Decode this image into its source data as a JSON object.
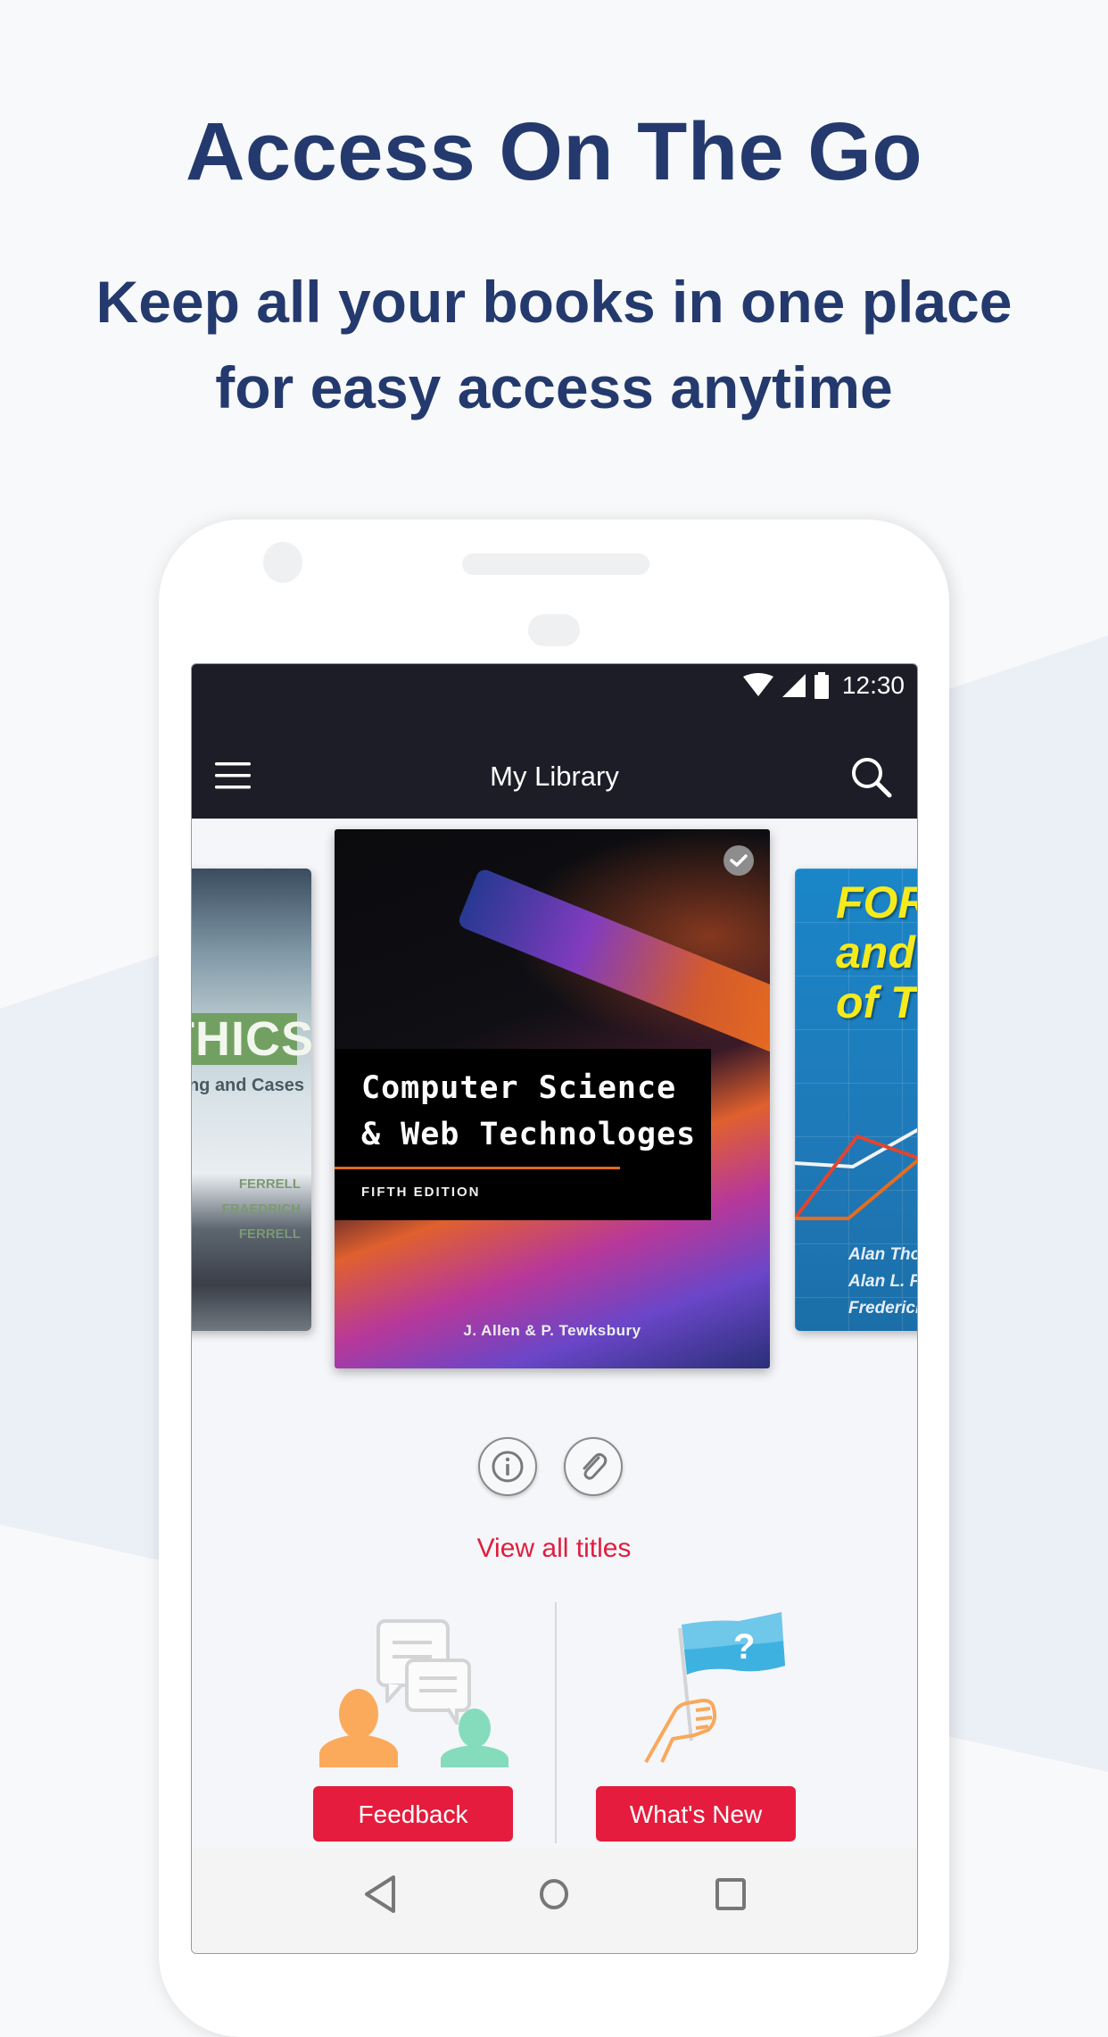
{
  "promo": {
    "headline": "Access On The Go",
    "subline_1": "Keep all your books in one place",
    "subline_2": "for easy access anytime"
  },
  "status_bar": {
    "time": "12:30",
    "icons": [
      "wifi-icon",
      "signal-icon",
      "battery-icon"
    ]
  },
  "app_bar": {
    "title": "My Library",
    "left_icon": "menu-icon",
    "right_icon": "search-icon"
  },
  "carousel": {
    "books": [
      {
        "position": "left",
        "title_partial": "THICS",
        "subtitle_partial": "ing and Cases",
        "authors": [
          "FERRELL",
          "FRAEDRICH",
          "FERRELL"
        ]
      },
      {
        "position": "center",
        "title_line_1": "Computer Science",
        "title_line_2": "& Web Technologes",
        "edition": "FIFTH EDITION",
        "author": "J. Allen & P. Tewksbury",
        "downloaded": true
      },
      {
        "position": "right",
        "title_lines": [
          "FORE",
          "and M",
          "of TEC"
        ],
        "authors": [
          "Alan Tho",
          "Alan L. P",
          "Frederick"
        ]
      }
    ]
  },
  "book_actions": {
    "info_icon": "info-icon",
    "attachment_icon": "paperclip-icon"
  },
  "view_all_label": "View all titles",
  "cards": {
    "feedback_label": "Feedback",
    "whats_new_label": "What's New"
  },
  "colors": {
    "title_navy": "#243a6e",
    "accent_red": "#e51c3d",
    "appbar_dark": "#1c1d26"
  },
  "nav_bar": {
    "icons": [
      "back-icon",
      "home-icon",
      "recents-icon"
    ]
  }
}
